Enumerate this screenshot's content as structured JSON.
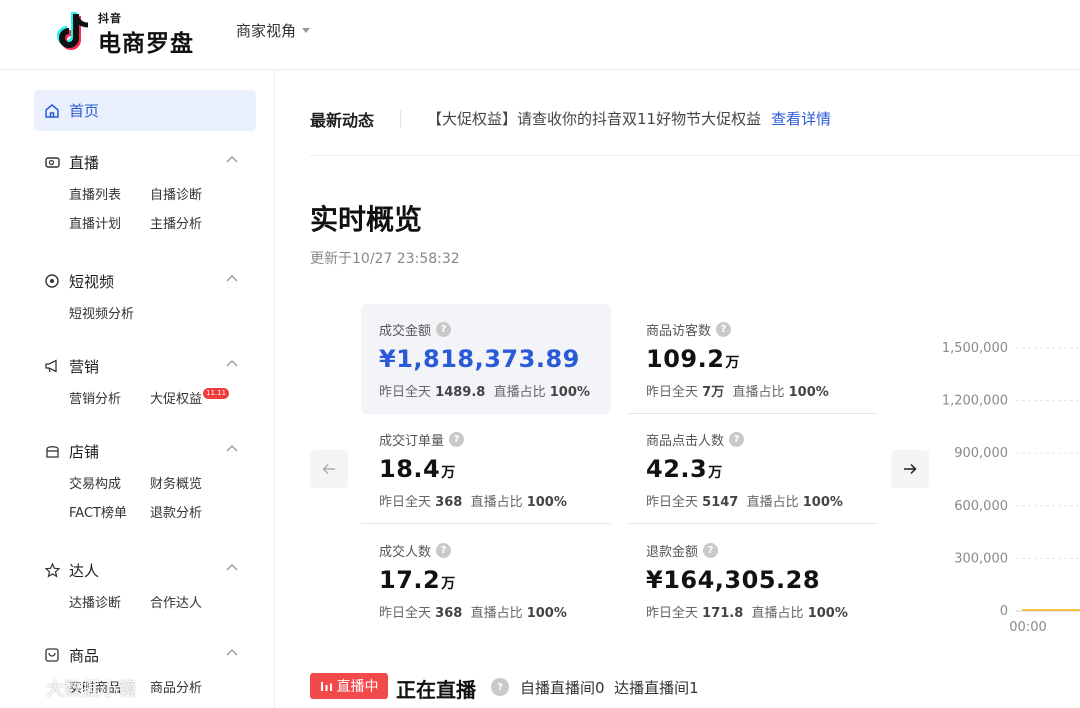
{
  "header": {
    "logo_small": "抖音",
    "logo_big": "电商罗盘",
    "view_switch": "商家视角"
  },
  "sidebar": {
    "home": "首页",
    "sections": {
      "live": {
        "title": "直播",
        "items": [
          "直播列表",
          "自播诊断",
          "直播计划",
          "主播分析"
        ]
      },
      "video": {
        "title": "短视频",
        "items": [
          "短视频分析"
        ]
      },
      "marketing": {
        "title": "营销",
        "items": [
          "营销分析",
          "大促权益"
        ],
        "badge": "11.11"
      },
      "store": {
        "title": "店铺",
        "items": [
          "交易构成",
          "财务概览",
          "FACT榜单",
          "退款分析"
        ]
      },
      "talent": {
        "title": "达人",
        "items": [
          "达播诊断",
          "合作达人"
        ]
      },
      "product": {
        "title": "商品",
        "items": [
          "实时商品",
          "商品分析"
        ]
      }
    }
  },
  "notice": {
    "title": "最新动态",
    "text": "【大促权益】请查收你的抖音双11好物节大促权益",
    "link": "查看详情"
  },
  "overview": {
    "title": "实时概览",
    "updated": "更新于10/27 23:58:32",
    "metrics": [
      {
        "label": "成交金额",
        "value": "¥1,818,373.89",
        "unit": "",
        "yesterday_label": "昨日全天",
        "yesterday": "1489.8",
        "share_label": "直播占比",
        "share": "100%"
      },
      {
        "label": "商品访客数",
        "value": "109.2",
        "unit": "万",
        "yesterday_label": "昨日全天",
        "yesterday": "7万",
        "share_label": "直播占比",
        "share": "100%"
      },
      {
        "label": "成交订单量",
        "value": "18.4",
        "unit": "万",
        "yesterday_label": "昨日全天",
        "yesterday": "368",
        "share_label": "直播占比",
        "share": "100%"
      },
      {
        "label": "商品点击人数",
        "value": "42.3",
        "unit": "万",
        "yesterday_label": "昨日全天",
        "yesterday": "5147",
        "share_label": "直播占比",
        "share": "100%"
      },
      {
        "label": "成交人数",
        "value": "17.2",
        "unit": "万",
        "yesterday_label": "昨日全天",
        "yesterday": "368",
        "share_label": "直播占比",
        "share": "100%"
      },
      {
        "label": "退款金额",
        "value": "¥164,305.28",
        "unit": "",
        "yesterday_label": "昨日全天",
        "yesterday": "171.8",
        "share_label": "直播占比",
        "share": "100%"
      }
    ],
    "chart": {
      "y_ticks": [
        "1,500,000",
        "1,200,000",
        "900,000",
        "600,000",
        "300,000",
        "0"
      ],
      "x_tick": "00:00"
    }
  },
  "live_now": {
    "badge": "直播中",
    "title": "正在直播",
    "self_label": "自播直播间",
    "self_count": "0",
    "talent_label": "达播直播间",
    "talent_count": "1"
  },
  "watermark": "大数据小镜"
}
